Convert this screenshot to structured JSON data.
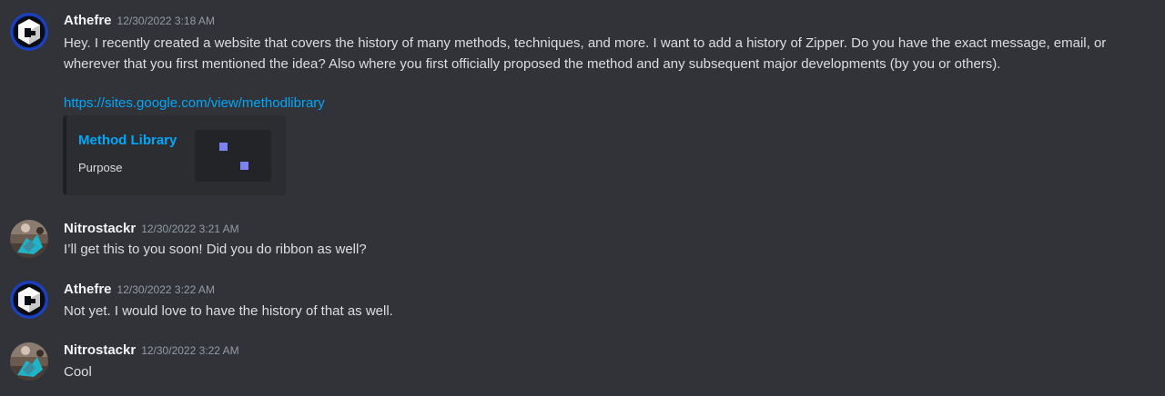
{
  "messages": [
    {
      "username": "Athefre",
      "timestamp": "12/30/2022 3:18 AM",
      "content": "Hey. I recently created a website that covers the history of many methods, techniques, and more. I want to add a history of Zipper. Do you have the exact message, email, or wherever that you first mentioned the idea? Also where you first officially proposed the method and any subsequent major developments (by you or others).",
      "link": "https://sites.google.com/view/methodlibrary",
      "embed": {
        "title": "Method Library",
        "description": "Purpose"
      }
    },
    {
      "username": "Nitrostackr",
      "timestamp": "12/30/2022 3:21 AM",
      "content": "I’ll get this to you soon! Did you do ribbon as well?"
    },
    {
      "username": "Athefre",
      "timestamp": "12/30/2022 3:22 AM",
      "content": "Not yet. I would love to have the history of that as well."
    },
    {
      "username": "Nitrostackr",
      "timestamp": "12/30/2022 3:22 AM",
      "content": "Cool"
    }
  ],
  "colors": {
    "background": "#313338",
    "username": "#f2f3f5",
    "timestamp": "#949ba4",
    "text": "#dbdee1",
    "link": "#00a8fc",
    "embed_background": "#2b2d31"
  },
  "icons": {
    "athefre_avatar": "cube-logo-avatar",
    "nitrostackr_avatar": "photo-avatar"
  }
}
